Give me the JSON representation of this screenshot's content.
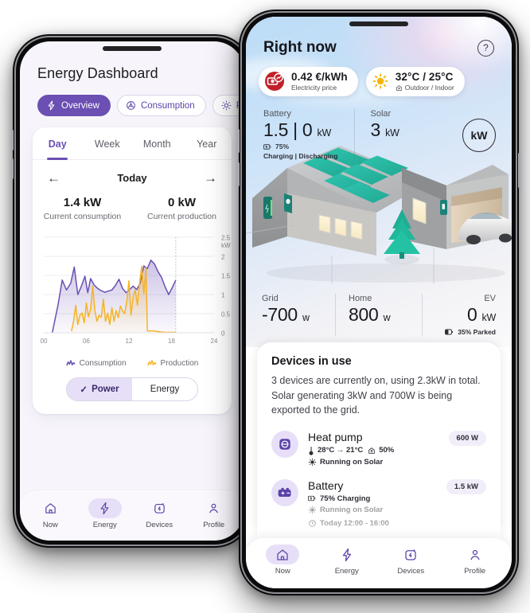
{
  "left_phone": {
    "title": "Energy Dashboard",
    "chips": [
      {
        "label": "Overview",
        "icon": "bolt-icon",
        "active": true
      },
      {
        "label": "Consumption",
        "icon": "consumption-icon",
        "active": false
      },
      {
        "label": "Production",
        "icon": "sun-icon",
        "active": false
      }
    ],
    "tabs": [
      {
        "label": "Day",
        "selected": true
      },
      {
        "label": "Week",
        "selected": false
      },
      {
        "label": "Month",
        "selected": false
      },
      {
        "label": "Year",
        "selected": false
      }
    ],
    "day_nav": {
      "prev": "←",
      "label": "Today",
      "next": "→"
    },
    "kpis": [
      {
        "value": "1.4 kW",
        "label": "Current consumption"
      },
      {
        "value": "0 kW",
        "label": "Current production"
      }
    ],
    "legend": [
      {
        "label": "Consumption",
        "color": "#6b4fb3"
      },
      {
        "label": "Production",
        "color": "#f5b423"
      }
    ],
    "segmented": [
      {
        "label": "Power",
        "selected": true,
        "check": "✓"
      },
      {
        "label": "Energy",
        "selected": false
      }
    ],
    "nav": [
      {
        "label": "Now",
        "icon": "home-icon",
        "active": false
      },
      {
        "label": "Energy",
        "icon": "bolt-icon",
        "active": true
      },
      {
        "label": "Devices",
        "icon": "devices-icon",
        "active": false
      },
      {
        "label": "Profile",
        "icon": "person-icon",
        "active": false
      }
    ]
  },
  "right_phone": {
    "title": "Right now",
    "help_icon": "?",
    "pills": [
      {
        "value": "0.42 €/kWh",
        "sub": "Electricity price",
        "icon": "price-tag-icon"
      },
      {
        "value": "32°C / 25°C",
        "sub": "Outdoor / Indoor",
        "icon": "sun-icon",
        "sub_icon": "house-icon"
      }
    ],
    "unit_badge": "kW",
    "stats_top": [
      {
        "label": "Battery",
        "value": "1.5 | 0",
        "unit": "kW",
        "sub": "75%",
        "sub_icon": "battery-icon",
        "sub2": "Charging | Discharging"
      },
      {
        "label": "Solar",
        "value": "3",
        "unit": "kW"
      }
    ],
    "stats_bottom": [
      {
        "label": "Grid",
        "value": "-700",
        "unit": "w"
      },
      {
        "label": "Home",
        "value": "800",
        "unit": "w"
      },
      {
        "label": "EV",
        "value": "0",
        "unit": "kW",
        "sub": "35% Parked",
        "sub_icon": "battery-icon"
      }
    ],
    "devices_card": {
      "title": "Devices in use",
      "summary": "3 devices are currently on, using 2.3kW in total. Solar generating 3kW and 700W is being exported to the grid.",
      "items": [
        {
          "name": "Heat pump",
          "badge": "600 W",
          "icon": "heat-pump-icon",
          "meta1": "28°C → 21°C",
          "meta1_icon": "thermometer-icon",
          "meta2": "50%",
          "meta2_icon": "house-icon",
          "meta3": "Running on Solar",
          "meta3_icon": "sun-icon"
        },
        {
          "name": "Battery",
          "badge": "1.5 kW",
          "icon": "battery-icon",
          "meta1": "75% Charging",
          "meta1_icon": "battery-icon",
          "meta3": "Running on Solar",
          "meta3_icon": "sun-icon",
          "meta4": "Today 12:00 - 16:00",
          "meta4_icon": "clock-icon"
        }
      ]
    },
    "nav": [
      {
        "label": "Now",
        "icon": "home-icon",
        "active": true
      },
      {
        "label": "Energy",
        "icon": "bolt-icon",
        "active": false
      },
      {
        "label": "Devices",
        "icon": "devices-icon",
        "active": false
      },
      {
        "label": "Profile",
        "icon": "person-icon",
        "active": false
      }
    ]
  },
  "chart_data": {
    "type": "area",
    "title": "Today",
    "xlabel": "",
    "ylabel": "kW",
    "xlim": [
      0,
      24
    ],
    "ylim": [
      0,
      2.5
    ],
    "xticks": [
      "00",
      "06",
      "12",
      "18",
      "24"
    ],
    "yticks": [
      "0",
      "0.5",
      "1",
      "1.5",
      "2",
      "2.5"
    ],
    "y_unit_label": "kW",
    "grid": true,
    "now_marker_x": 18.6,
    "legend_position": "bottom",
    "series": [
      {
        "name": "Consumption",
        "color": "#6b4fb3",
        "x": [
          1.2,
          2.0,
          2.6,
          3.2,
          3.8,
          4.3,
          4.8,
          5.3,
          5.8,
          6.2,
          6.6,
          7.1,
          7.6,
          8.1,
          8.6,
          9.1,
          9.6,
          10.1,
          10.6,
          11.1,
          11.6,
          12.1,
          12.6,
          13.1,
          13.6,
          14.1,
          14.6,
          15.1,
          15.6,
          16.1,
          16.6,
          17.1,
          17.6,
          18.1,
          18.6
        ],
        "y": [
          0.0,
          0.72,
          1.38,
          1.12,
          1.3,
          1.72,
          1.0,
          1.22,
          1.48,
          1.05,
          1.42,
          1.25,
          1.16,
          1.1,
          1.06,
          1.09,
          1.12,
          1.24,
          1.4,
          1.16,
          1.05,
          1.13,
          1.22,
          1.13,
          1.3,
          1.75,
          1.68,
          1.9,
          1.8,
          1.6,
          1.45,
          1.2,
          1.0,
          1.18,
          1.38
        ]
      },
      {
        "name": "Production",
        "color": "#f5b423",
        "x": [
          3.9,
          4.2,
          4.5,
          4.8,
          5.1,
          5.4,
          5.7,
          6.0,
          6.3,
          6.6,
          6.9,
          7.2,
          7.5,
          7.8,
          8.1,
          8.4,
          8.7,
          9.0,
          9.3,
          9.6,
          9.9,
          10.2,
          10.5,
          10.8,
          11.1,
          11.4,
          11.7,
          12.0,
          12.3,
          12.6,
          12.9,
          13.2,
          13.5,
          13.8,
          14.1,
          14.4,
          14.6,
          14.9,
          15.4,
          16.5,
          17.2,
          18.0,
          18.6
        ],
        "y": [
          0.04,
          0.3,
          0.72,
          0.22,
          0.46,
          0.52,
          0.26,
          0.78,
          0.42,
          0.62,
          1.22,
          0.58,
          0.3,
          0.46,
          0.4,
          0.88,
          0.3,
          0.52,
          0.22,
          0.66,
          0.3,
          0.58,
          0.4,
          0.7,
          0.58,
          0.5,
          0.82,
          1.36,
          0.46,
          0.96,
          1.12,
          0.72,
          1.3,
          1.74,
          1.02,
          1.7,
          0.05,
          0.05,
          0.05,
          0.02,
          0.01,
          0.01,
          0.01
        ]
      }
    ]
  }
}
